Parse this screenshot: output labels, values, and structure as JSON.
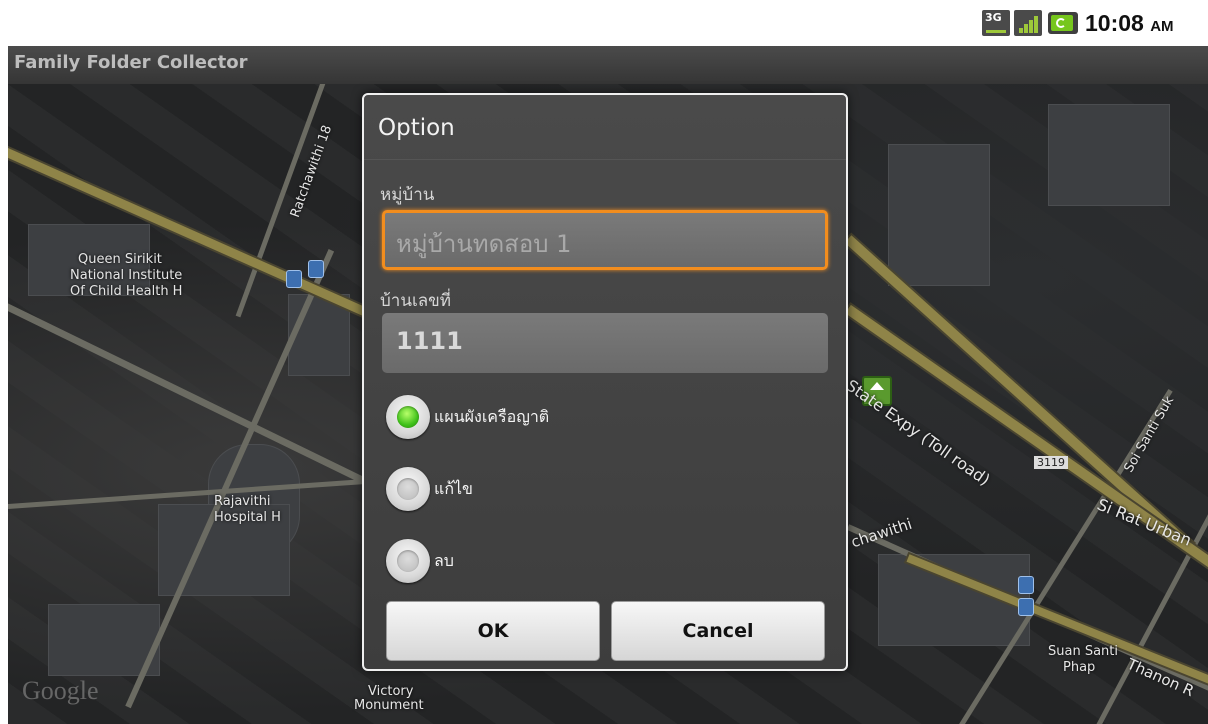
{
  "status_bar": {
    "network": "3G",
    "time": "10:08",
    "ampm": "AM"
  },
  "app": {
    "title": "Family Folder Collector"
  },
  "map": {
    "attribution": "Google",
    "labels": {
      "l1": "Queen Sirikit",
      "l2": "National Institute",
      "l3": "Of Child Health H",
      "l4": "Ratchawithi 18",
      "l5": "Rajavithi",
      "l6": "Hospital H",
      "l7": "State Expy (Toll road)",
      "l8": "3119",
      "l9": "Si Rat Urban",
      "l10": "Suan Santi",
      "l11": "Phap",
      "l12": "Thanon R",
      "l13": "Victory",
      "l14": "Monument",
      "l15": "Soi Santi Suk",
      "l16": "chawithi"
    }
  },
  "dialog": {
    "title": "Option",
    "village_label": "หมู่บ้าน",
    "village_value": "หมู่บ้านทดสอบ 1",
    "house_label": "บ้านเลขที่",
    "house_value": "1111",
    "options": [
      {
        "label": "แผนผังเครือญาติ",
        "checked": true
      },
      {
        "label": "แก้ไข",
        "checked": false
      },
      {
        "label": "ลบ",
        "checked": false
      }
    ],
    "ok_label": "OK",
    "cancel_label": "Cancel"
  }
}
